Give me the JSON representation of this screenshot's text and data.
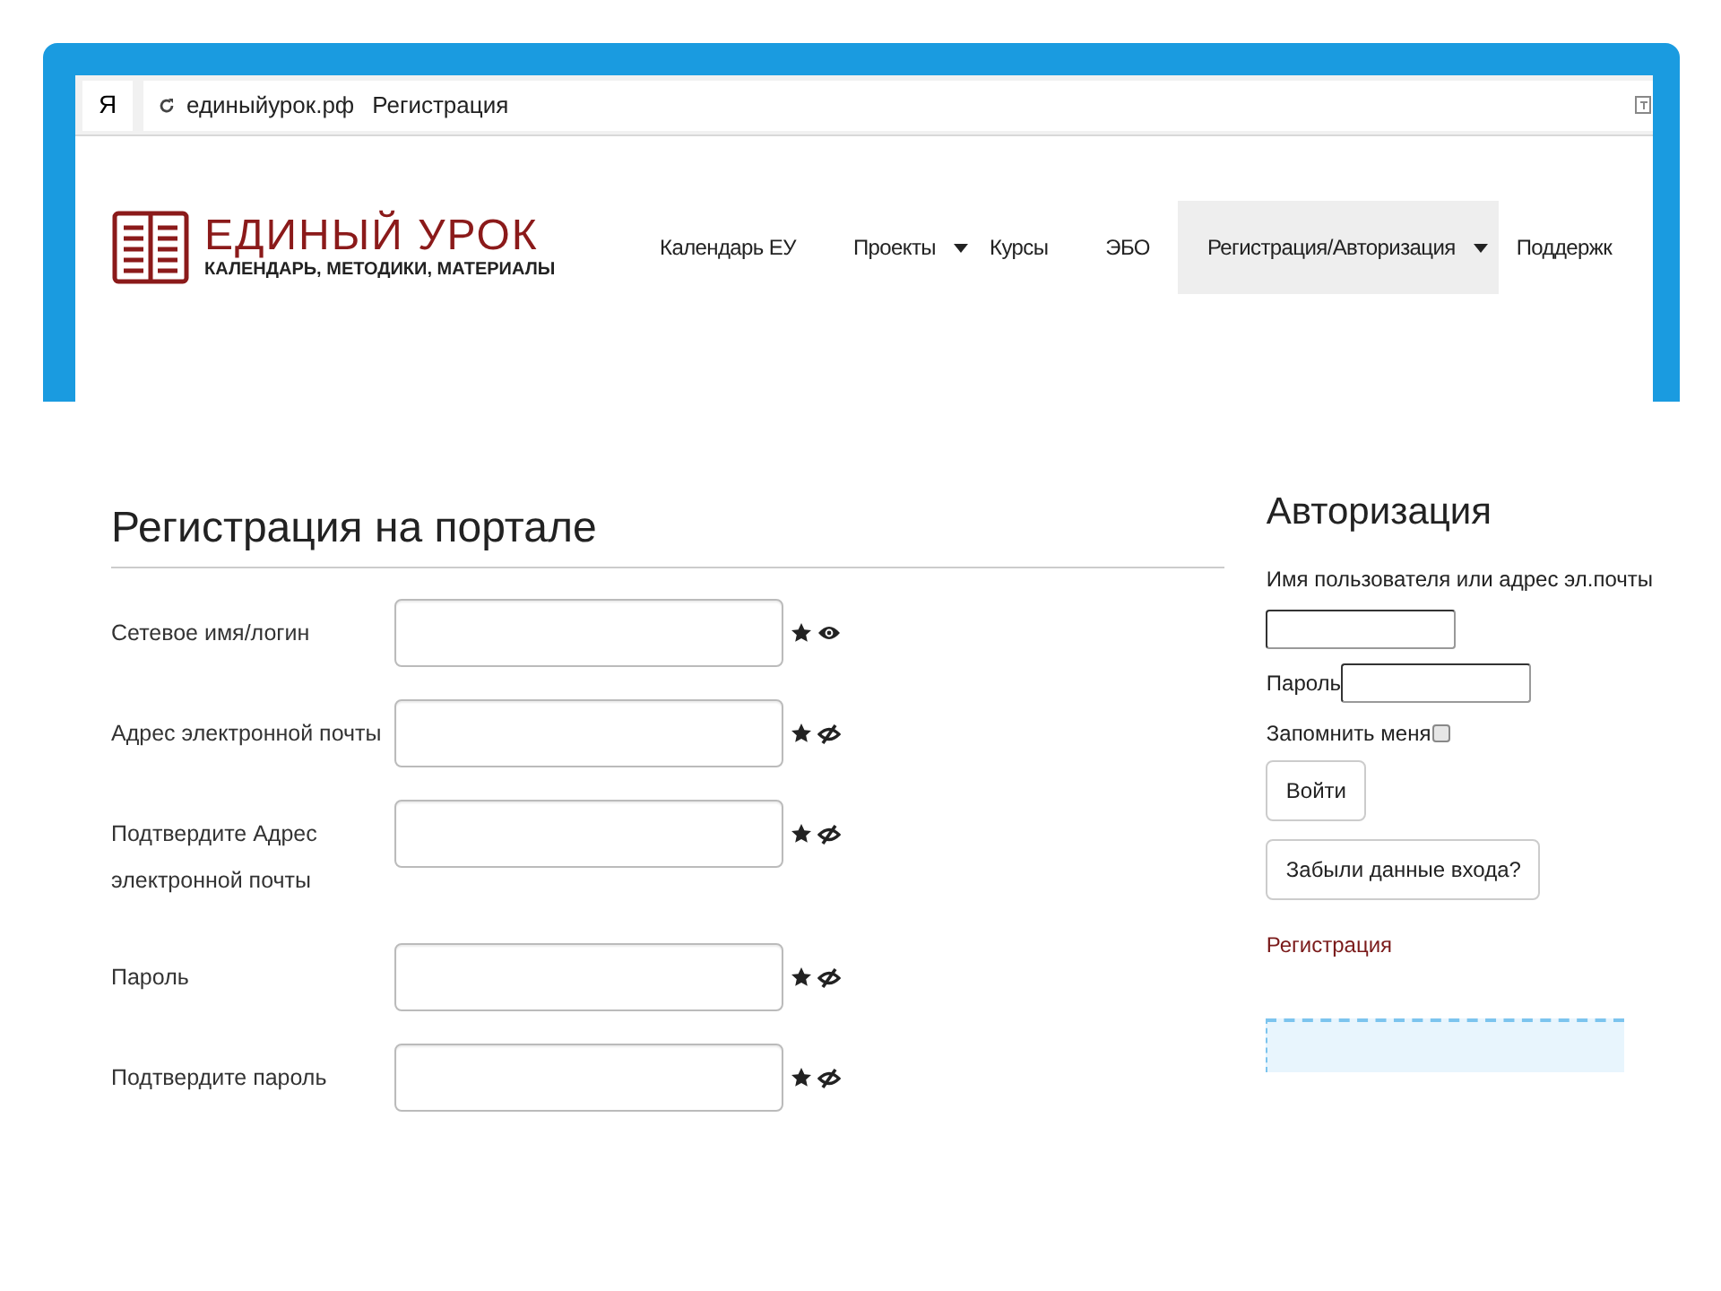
{
  "browser": {
    "home_key": "Я",
    "address": "единыйурок.рф",
    "page_title": "Регистрация"
  },
  "site": {
    "logo_title": "ЕДИНЫЙ УРОК",
    "logo_tagline": "КАЛЕНДАРЬ, МЕТОДИКИ, МАТЕРИАЛЫ"
  },
  "nav": [
    {
      "label": "Календарь ЕУ",
      "dropdown": false,
      "selected": false
    },
    {
      "label": "Проекты",
      "dropdown": true,
      "selected": false
    },
    {
      "label": "Курсы",
      "dropdown": false,
      "selected": false
    },
    {
      "label": "ЭБО",
      "dropdown": false,
      "selected": false
    },
    {
      "label": "Регистрация/Авторизация",
      "dropdown": true,
      "selected": true
    },
    {
      "label": "Поддержк",
      "dropdown": false,
      "selected": false
    }
  ],
  "registration": {
    "title": "Регистрация на портале",
    "fields": [
      {
        "label": "Сетевое имя/логин",
        "required": true,
        "visible": true
      },
      {
        "label": "Адрес электронной почты",
        "required": true,
        "visible": false
      },
      {
        "label": "Подтвердите Адрес электронной почты",
        "required": true,
        "visible": false
      },
      {
        "label": "Пароль",
        "required": true,
        "visible": false
      },
      {
        "label": "Подтвердите пароль",
        "required": true,
        "visible": false
      }
    ]
  },
  "login": {
    "title": "Авторизация",
    "username_label": "Имя пользователя или адрес эл.почты",
    "password_label": "Пароль",
    "remember_label": "Запомнить меня",
    "remember_checked": false,
    "buttons": [
      "Войти",
      "Забыли данные входа?"
    ],
    "register_link": "Регистрация"
  }
}
